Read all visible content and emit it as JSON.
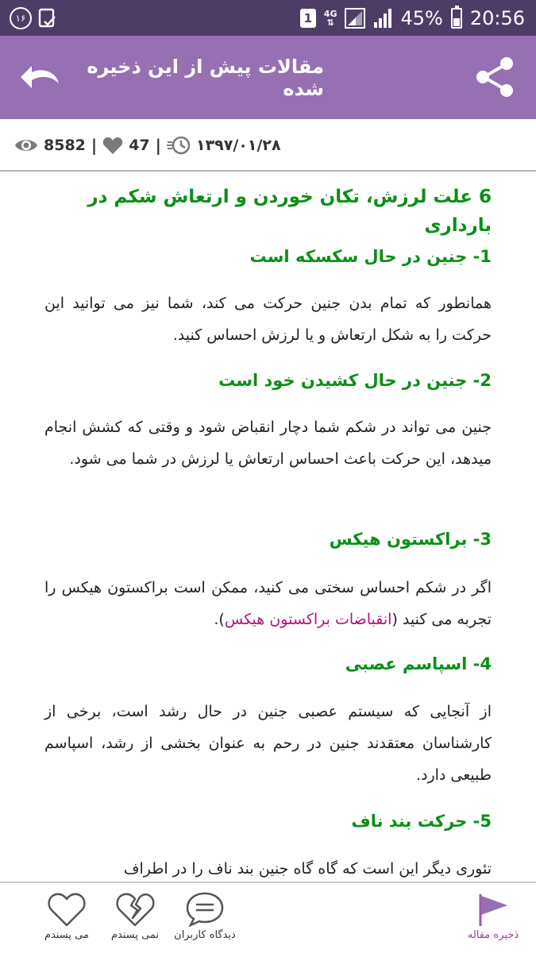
{
  "status_bar": {
    "notification_count": "۱۶",
    "sim_slot": "1",
    "network_type": "4G",
    "battery_percent": "45%",
    "time": "20:56"
  },
  "toolbar": {
    "title": "مقالات پیش از این ذخیره شده"
  },
  "meta": {
    "views": "8582",
    "likes": "47",
    "separator": "|",
    "date": "۱۳۹۷/۰۱/۲۸"
  },
  "article": {
    "title": "6 علت لرزش، تکان خوردن و ارتعاش شکم در بارداری",
    "sections": [
      {
        "heading": "1- جنین در حال سکسکه است",
        "body": "همانطور که تمام بدن جنین حرکت می کند، شما نیز می توانید این حرکت را به شکل ارتعاش و یا لرزش احساس کنید."
      },
      {
        "heading": "2- جنین در حال کشیدن خود است",
        "body": "جنین می تواند در شکم شما دچار انقباض شود و وقتی که کشش انجام میدهد، این حرکت باعث احساس ارتعاش یا لرزش در شما می شود."
      },
      {
        "heading": "3-  براکستون هیکس",
        "body_before": "اگر در شکم احساس سختی می کنید، ممکن است براکستون هیکس را تجربه می کنید (",
        "body_link": "انقباضات براکستون هیکس",
        "body_after": ")."
      },
      {
        "heading": "4-  اسپاسم عصبی",
        "body": "از آنجایی که سیستم عصبی جنین در حال رشد است، برخی از کارشناسان معتقدند جنین در رحم به عنوان بخشی از رشد، اسپاسم طبیعی دارد."
      },
      {
        "heading": "5-  حرکت بند ناف",
        "body": "تئوری دیگر این است که گاه گاه جنین بند ناف را در اطراف"
      }
    ]
  },
  "bottom_nav": {
    "save": "ذخیره مقاله",
    "comments": "دیدگاه کاربران",
    "dislike": "نمی پسندم",
    "like": "می پسندم"
  },
  "colors": {
    "status_bar": "#4d3d66",
    "toolbar": "#9670b2",
    "heading_green": "#0b8f16",
    "link_magenta": "#b0147a"
  }
}
